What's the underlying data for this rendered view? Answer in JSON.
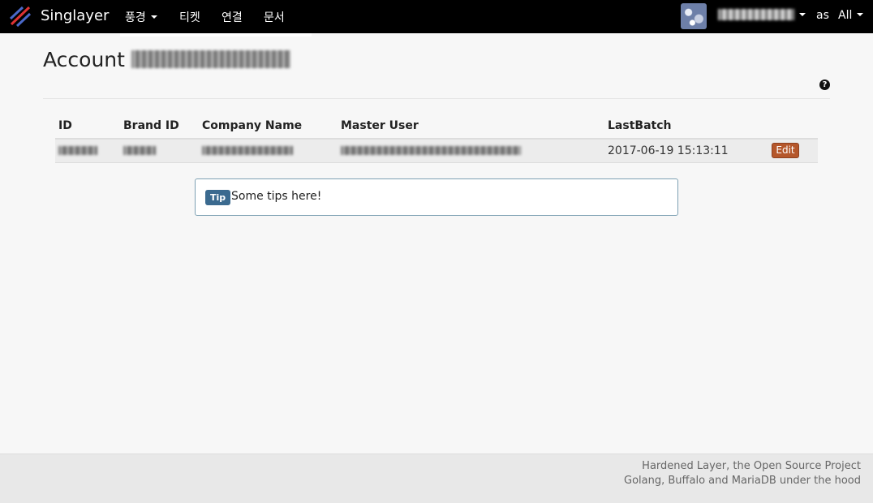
{
  "navbar": {
    "brand": "Singlayer",
    "menu": [
      {
        "label": "풍경",
        "dropdown": true
      },
      {
        "label": "티켓"
      },
      {
        "label": "연결"
      },
      {
        "label": "문서"
      }
    ],
    "as_label": "as",
    "scope_label": "All"
  },
  "page": {
    "title_prefix": "Account"
  },
  "table": {
    "headers": {
      "id": "ID",
      "brand_id": "Brand ID",
      "company_name": "Company Name",
      "master_user": "Master User",
      "last_batch": "LastBatch"
    },
    "rows": [
      {
        "last_batch": "2017-06-19 15:13:11",
        "edit_label": "Edit"
      }
    ]
  },
  "tip": {
    "label": "Tip",
    "text": "Some tips here!"
  },
  "footer": {
    "line1": "Hardened Layer, the Open Source Project",
    "line2": "Golang, Buffalo and MariaDB under the hood"
  },
  "colors": {
    "navbar_bg": "#000000",
    "edit_button": "#b5572b",
    "tip_badge": "#3b6a8f",
    "page_bg": "#f7f7f7"
  },
  "icons": {
    "brand": "singlayer-logo-icon",
    "help": "question-circle-icon"
  }
}
